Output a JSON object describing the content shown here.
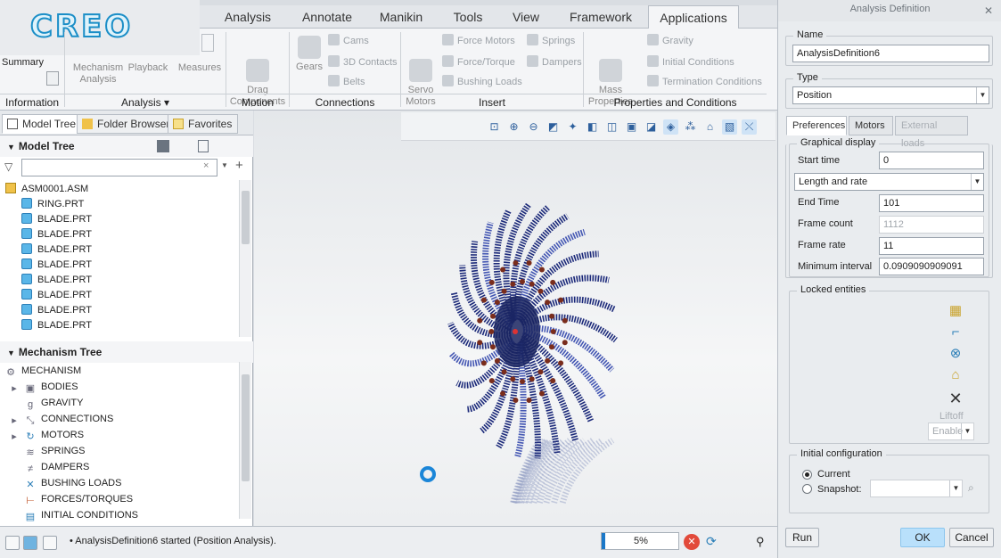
{
  "app": {
    "logo": "CREO",
    "ribbon_tabs": [
      "Analysis",
      "Annotate",
      "Manikin",
      "Tools",
      "View",
      "Framework",
      "Applications"
    ],
    "active_tab": "Applications"
  },
  "ribbon": {
    "information": {
      "summary": "Summary",
      "label": "Information"
    },
    "analysis": {
      "mechanism_analysis": "Mechanism\nAnalysis",
      "playback": "Playback",
      "measures": "Measures",
      "label": "Analysis ▾"
    },
    "motion": {
      "drag": "Drag\nComponents",
      "label": "Motion"
    },
    "connections": {
      "gears": "Gears",
      "cams": "Cams",
      "contacts": "3D Contacts",
      "belts": "Belts",
      "label": "Connections"
    },
    "insert": {
      "servo": "Servo\nMotors",
      "force_motors": "Force Motors",
      "springs": "Springs",
      "force_torque": "Force/Torque",
      "dampers": "Dampers",
      "bushing": "Bushing Loads",
      "label": "Insert"
    },
    "properties": {
      "mass": "Mass\nProperties",
      "gravity": "Gravity",
      "initial": "Initial Conditions",
      "termination": "Termination Conditions",
      "label": "Properties and Conditions"
    }
  },
  "left_panel": {
    "tabs": [
      "Model Tree",
      "Folder Browser",
      "Favorites"
    ],
    "model_tree_title": "Model Tree",
    "model_tree": [
      "ASM0001.ASM",
      "RING.PRT",
      "BLADE.PRT",
      "BLADE.PRT",
      "BLADE.PRT",
      "BLADE.PRT",
      "BLADE.PRT",
      "BLADE.PRT",
      "BLADE.PRT",
      "BLADE.PRT"
    ],
    "mechanism_tree_title": "Mechanism Tree",
    "mechanism_tree": [
      "MECHANISM",
      "BODIES",
      "GRAVITY",
      "CONNECTIONS",
      "MOTORS",
      "SPRINGS",
      "DAMPERS",
      "BUSHING LOADS",
      "FORCES/TORQUES",
      "INITIAL CONDITIONS"
    ]
  },
  "status": {
    "message": "• AnalysisDefinition6 started (Position Analysis).",
    "progress_text": "5%",
    "progress_fraction": 0.05
  },
  "dialog": {
    "title": "Analysis Definition",
    "close": "✕",
    "name_label": "Name",
    "name_value": "AnalysisDefinition6",
    "type_label": "Type",
    "type_value": "Position",
    "tabs": [
      "Preferences",
      "Motors",
      "External loads"
    ],
    "graphical_display": "Graphical display",
    "start_time_label": "Start time",
    "start_time": "0",
    "mode": "Length and rate",
    "end_time_label": "End Time",
    "end_time": "101",
    "frame_count_label": "Frame count",
    "frame_count": "1112",
    "frame_rate_label": "Frame rate",
    "frame_rate": "11",
    "min_interval_label": "Minimum interval",
    "min_interval": "0.0909090909091",
    "locked_label": "Locked entities",
    "liftoff": "Liftoff",
    "enable": "Enable",
    "initial_config_label": "Initial configuration",
    "current": "Current",
    "snapshot": "Snapshot:",
    "run": "Run",
    "ok": "OK",
    "cancel": "Cancel"
  }
}
